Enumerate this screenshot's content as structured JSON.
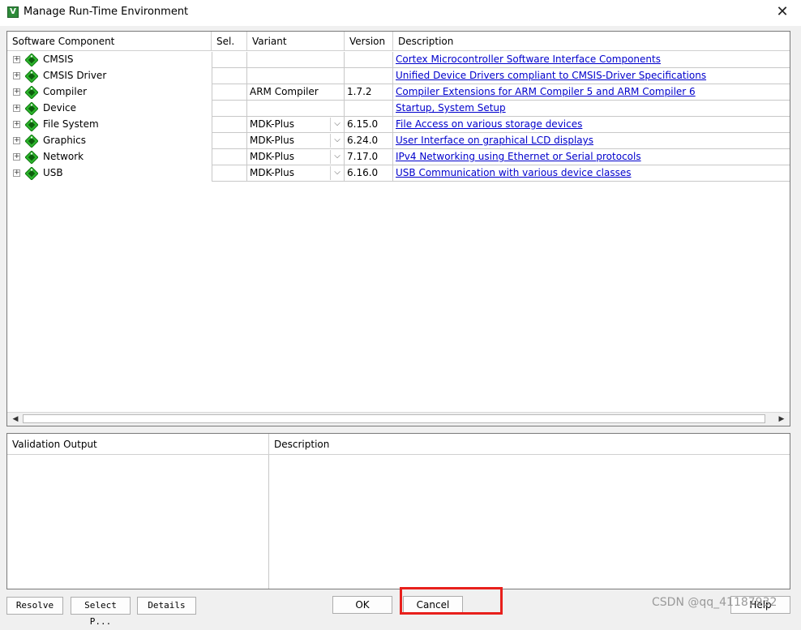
{
  "window": {
    "title": "Manage Run-Time Environment",
    "close_glyph": "✕",
    "icon_letter": "V"
  },
  "components": {
    "columns": [
      "Software Component",
      "Sel.",
      "Variant",
      "Version",
      "Description"
    ],
    "rows": [
      {
        "name": "CMSIS",
        "variant": "",
        "has_dropdown": false,
        "version": "",
        "description": "Cortex Microcontroller Software Interface Components"
      },
      {
        "name": "CMSIS Driver",
        "variant": "",
        "has_dropdown": false,
        "version": "",
        "description": "Unified Device Drivers compliant to CMSIS-Driver Specifications"
      },
      {
        "name": "Compiler",
        "variant": "ARM Compiler",
        "has_dropdown": false,
        "version": "1.7.2",
        "description": "Compiler Extensions for ARM Compiler 5 and ARM Compiler 6"
      },
      {
        "name": "Device",
        "variant": "",
        "has_dropdown": false,
        "version": "",
        "description": "Startup, System Setup"
      },
      {
        "name": "File System",
        "variant": "MDK-Plus",
        "has_dropdown": true,
        "version": "6.15.0",
        "description": "File Access on various storage devices"
      },
      {
        "name": "Graphics",
        "variant": "MDK-Plus",
        "has_dropdown": true,
        "version": "6.24.0",
        "description": "User Interface on graphical LCD displays"
      },
      {
        "name": "Network",
        "variant": "MDK-Plus",
        "has_dropdown": true,
        "version": "7.17.0",
        "description": "IPv4 Networking using Ethernet or Serial protocols"
      },
      {
        "name": "USB",
        "variant": "MDK-Plus",
        "has_dropdown": true,
        "version": "6.16.0",
        "description": "USB Communication with various device classes"
      }
    ]
  },
  "validation": {
    "columns": [
      "Validation Output",
      "Description"
    ]
  },
  "buttons": {
    "resolve": "Resolve",
    "select_packs": "Select P...",
    "details": "Details",
    "ok": "OK",
    "cancel": "Cancel",
    "help": "Help"
  },
  "watermark": "CSDN @qq_41187932",
  "colors": {
    "link": "#0000cc",
    "gem": "#2db52d",
    "highlight": "#e8201c"
  }
}
